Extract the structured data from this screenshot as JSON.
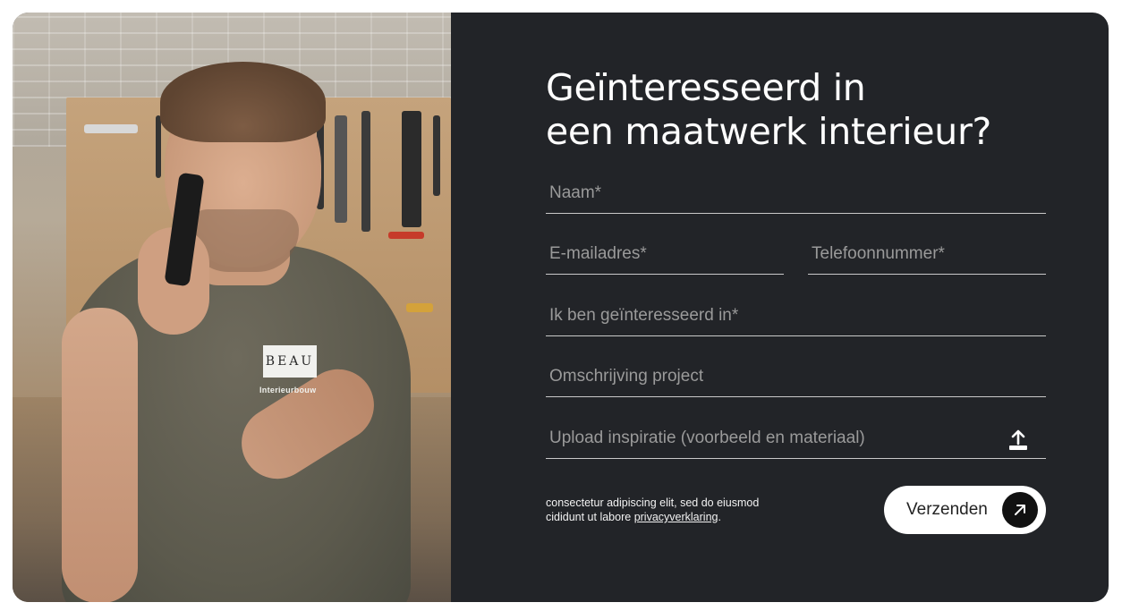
{
  "heading": "Geïnteresseerd in\neen maatwerk interieur?",
  "photo": {
    "logo_text": "BEAU",
    "logo_subtext": "Interieurbouw"
  },
  "form": {
    "name_placeholder": "Naam*",
    "email_placeholder": "E-mailadres*",
    "phone_placeholder": "Telefoonnummer*",
    "interest_placeholder": "Ik ben geïnteresseerd in*",
    "description_placeholder": "Omschrijving project",
    "upload_placeholder": "Upload inspiratie (voorbeeld en materiaal)",
    "upload_icon": "upload-icon"
  },
  "consent": {
    "text": "consectetur adipiscing elit, sed do eiusmod cididunt ut labore ",
    "link_label": "privacyverklaring",
    "suffix": "."
  },
  "submit": {
    "label": "Verzenden",
    "icon": "arrow-up-right-icon"
  },
  "colors": {
    "panel_bg": "#222428",
    "text": "#ffffff",
    "placeholder": "#9a9a9a",
    "button_bg": "#ffffff",
    "button_icon_bg": "#111111"
  }
}
